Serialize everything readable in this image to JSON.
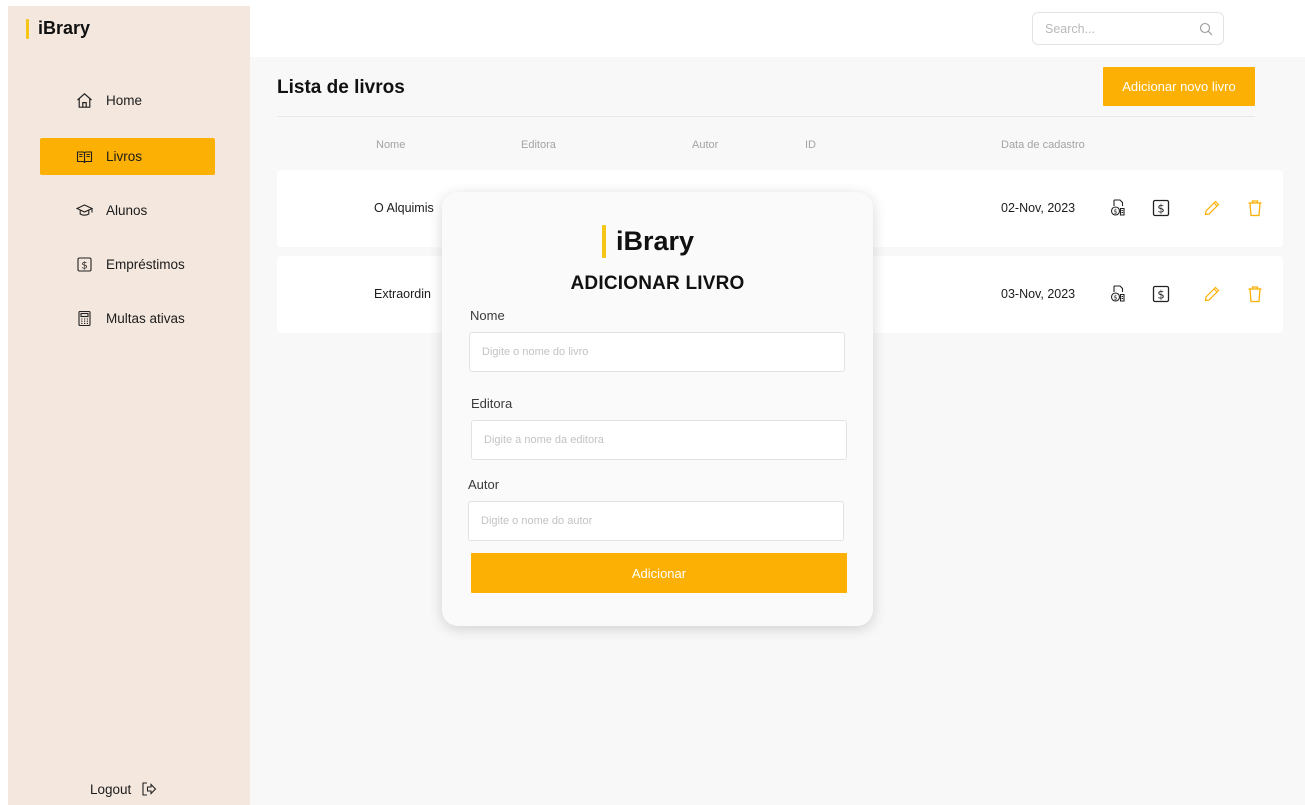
{
  "app": {
    "name": "iBrary"
  },
  "sidebar": {
    "items": [
      {
        "label": "Home",
        "icon": "home-icon",
        "active": false
      },
      {
        "label": "Livros",
        "icon": "book-icon",
        "active": true
      },
      {
        "label": "Alunos",
        "icon": "graduation-cap-icon",
        "active": false
      },
      {
        "label": "Empréstimos",
        "icon": "dollar-box-icon",
        "active": false
      },
      {
        "label": "Multas ativas",
        "icon": "calculator-icon",
        "active": false
      }
    ],
    "logout_label": "Logout"
  },
  "search": {
    "placeholder": "Search..."
  },
  "main": {
    "title": "Lista de livros",
    "add_button_label": "Adicionar novo livro",
    "columns": [
      "Nome",
      "Editora",
      "Autor",
      "ID",
      "Data de cadastro"
    ],
    "rows": [
      {
        "name": "O Alquimis",
        "date": "02-Nov, 2023"
      },
      {
        "name": "Extraordin",
        "date": "03-Nov, 2023"
      }
    ]
  },
  "modal": {
    "logo": "iBrary",
    "title": "ADICIONAR LIVRO",
    "fields": [
      {
        "label": "Nome",
        "placeholder": "Digite o nome do livro"
      },
      {
        "label": "Editora",
        "placeholder": "Digite a nome da editora"
      },
      {
        "label": "Autor",
        "placeholder": "Digite o nome do autor"
      }
    ],
    "submit_label": "Adicionar"
  },
  "colors": {
    "accent": "#fbb003",
    "logo_bar": "#f5c518",
    "sidebar_bg": "#f3e7de"
  }
}
